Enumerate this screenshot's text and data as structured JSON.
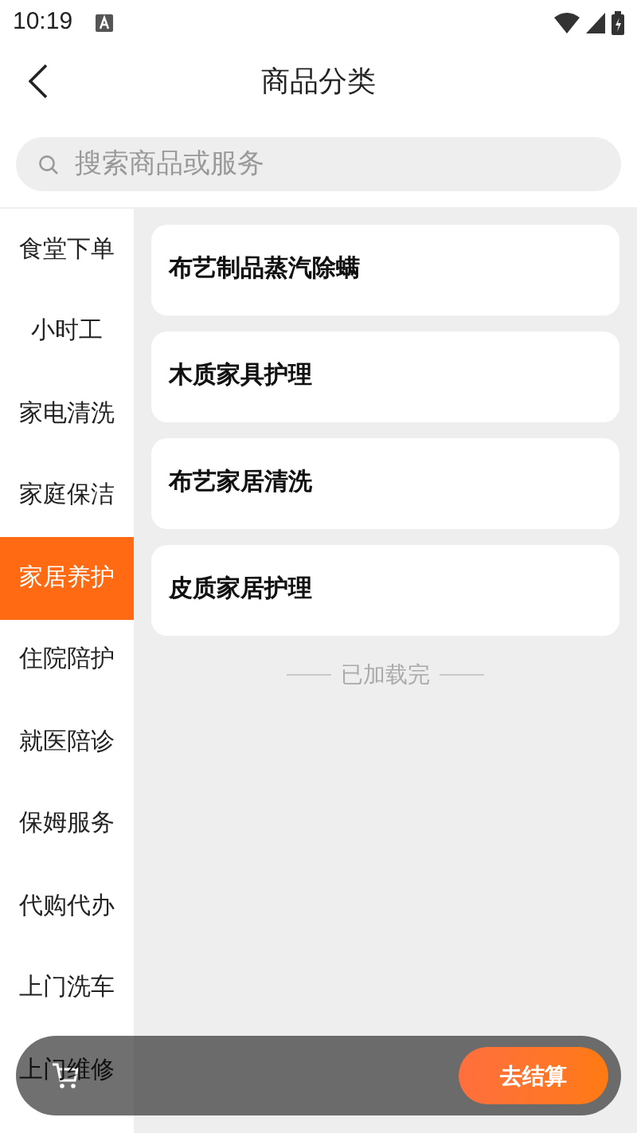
{
  "status_bar": {
    "time": "10:19"
  },
  "header": {
    "title": "商品分类"
  },
  "search": {
    "placeholder": "搜索商品或服务"
  },
  "categories": [
    {
      "label": "食堂下单",
      "selected": false
    },
    {
      "label": "小时工",
      "selected": false
    },
    {
      "label": "家电清洗",
      "selected": false
    },
    {
      "label": "家庭保洁",
      "selected": false
    },
    {
      "label": "家居养护",
      "selected": true
    },
    {
      "label": "住院陪护",
      "selected": false
    },
    {
      "label": "就医陪诊",
      "selected": false
    },
    {
      "label": "保姆服务",
      "selected": false
    },
    {
      "label": "代购代办",
      "selected": false
    },
    {
      "label": "上门洗车",
      "selected": false
    },
    {
      "label": "上门维修",
      "selected": false
    }
  ],
  "products": [
    {
      "name": "布艺制品蒸汽除螨"
    },
    {
      "name": "木质家具护理"
    },
    {
      "name": "布艺家居清洗"
    },
    {
      "name": "皮质家居护理"
    }
  ],
  "list_end": "已加载完",
  "cart_bar": {
    "checkout": "去结算"
  }
}
